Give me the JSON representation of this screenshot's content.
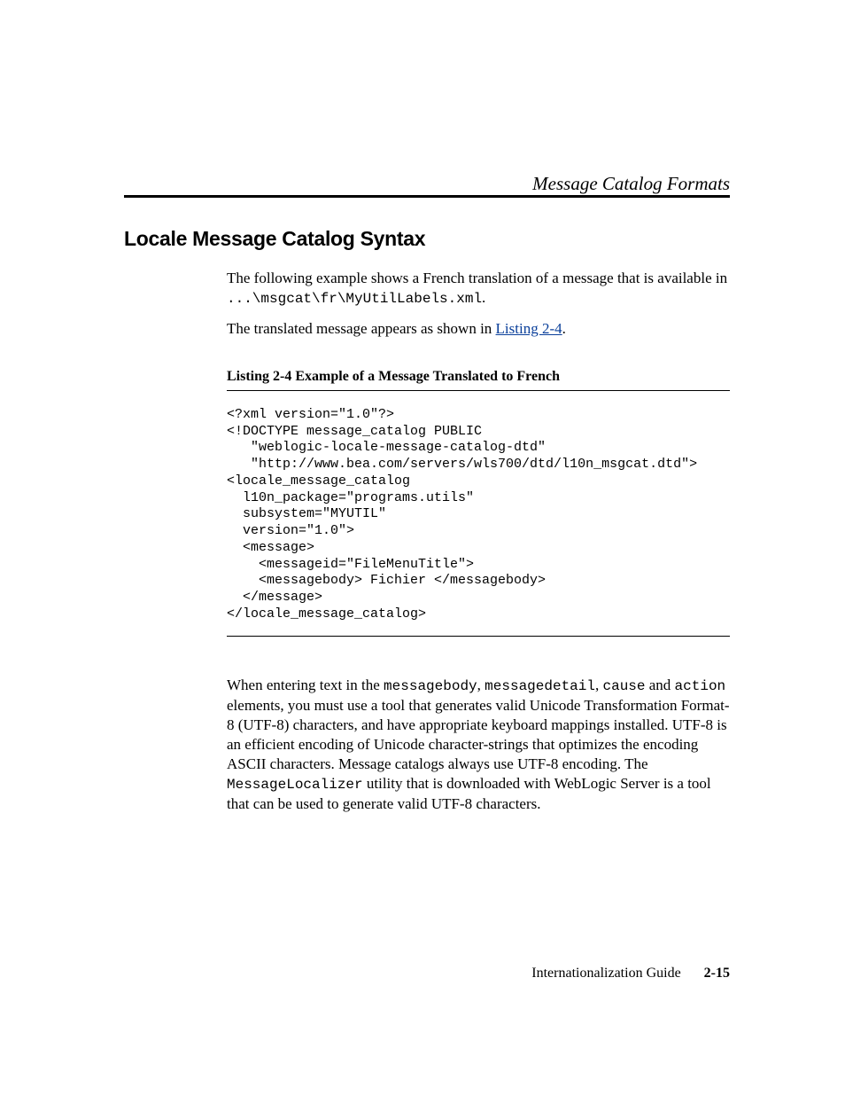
{
  "header": {
    "running_title": "Message Catalog Formats"
  },
  "section": {
    "title": "Locale Message Catalog Syntax",
    "intro_pre": "The following example shows a French translation of a message that is available in ",
    "intro_path": "...\\msgcat\\fr\\MyUtilLabels.xml",
    "intro_post": ".",
    "p2_pre": "The translated message appears as shown in ",
    "p2_link": "Listing 2-4",
    "p2_post": "."
  },
  "listing": {
    "caption": "Listing 2-4   Example of a Message Translated to French",
    "code": "<?xml version=\"1.0\"?>\n<!DOCTYPE message_catalog PUBLIC\n   \"weblogic-locale-message-catalog-dtd\"\n   \"http://www.bea.com/servers/wls700/dtd/l10n_msgcat.dtd\">\n<locale_message_catalog\n  l10n_package=\"programs.utils\"\n  subsystem=\"MYUTIL\"\n  version=\"1.0\">\n  <message>\n    <messageid=\"FileMenuTitle\">\n    <messagebody> Fichier </messagebody>\n  </message>\n</locale_message_catalog>"
  },
  "after": {
    "t1": "When entering text in the ",
    "c1": "messagebody",
    "t2": ", ",
    "c2": "messagedetail",
    "t3": ", ",
    "c3": "cause",
    "t4": " and ",
    "c4": "action",
    "t5": " elements, you must use a tool that generates valid Unicode Transformation Format-8 (UTF-8) characters, and have appropriate keyboard mappings installed. UTF-8 is an efficient encoding of Unicode character-strings that optimizes the encoding ASCII characters. Message catalogs always use UTF-8 encoding. The ",
    "c5": "MessageLocalizer",
    "t6": " utility that is downloaded with WebLogic Server is a tool that can be used to generate valid UTF-8 characters."
  },
  "footer": {
    "guide": "Internationalization Guide",
    "page": "2-15"
  }
}
